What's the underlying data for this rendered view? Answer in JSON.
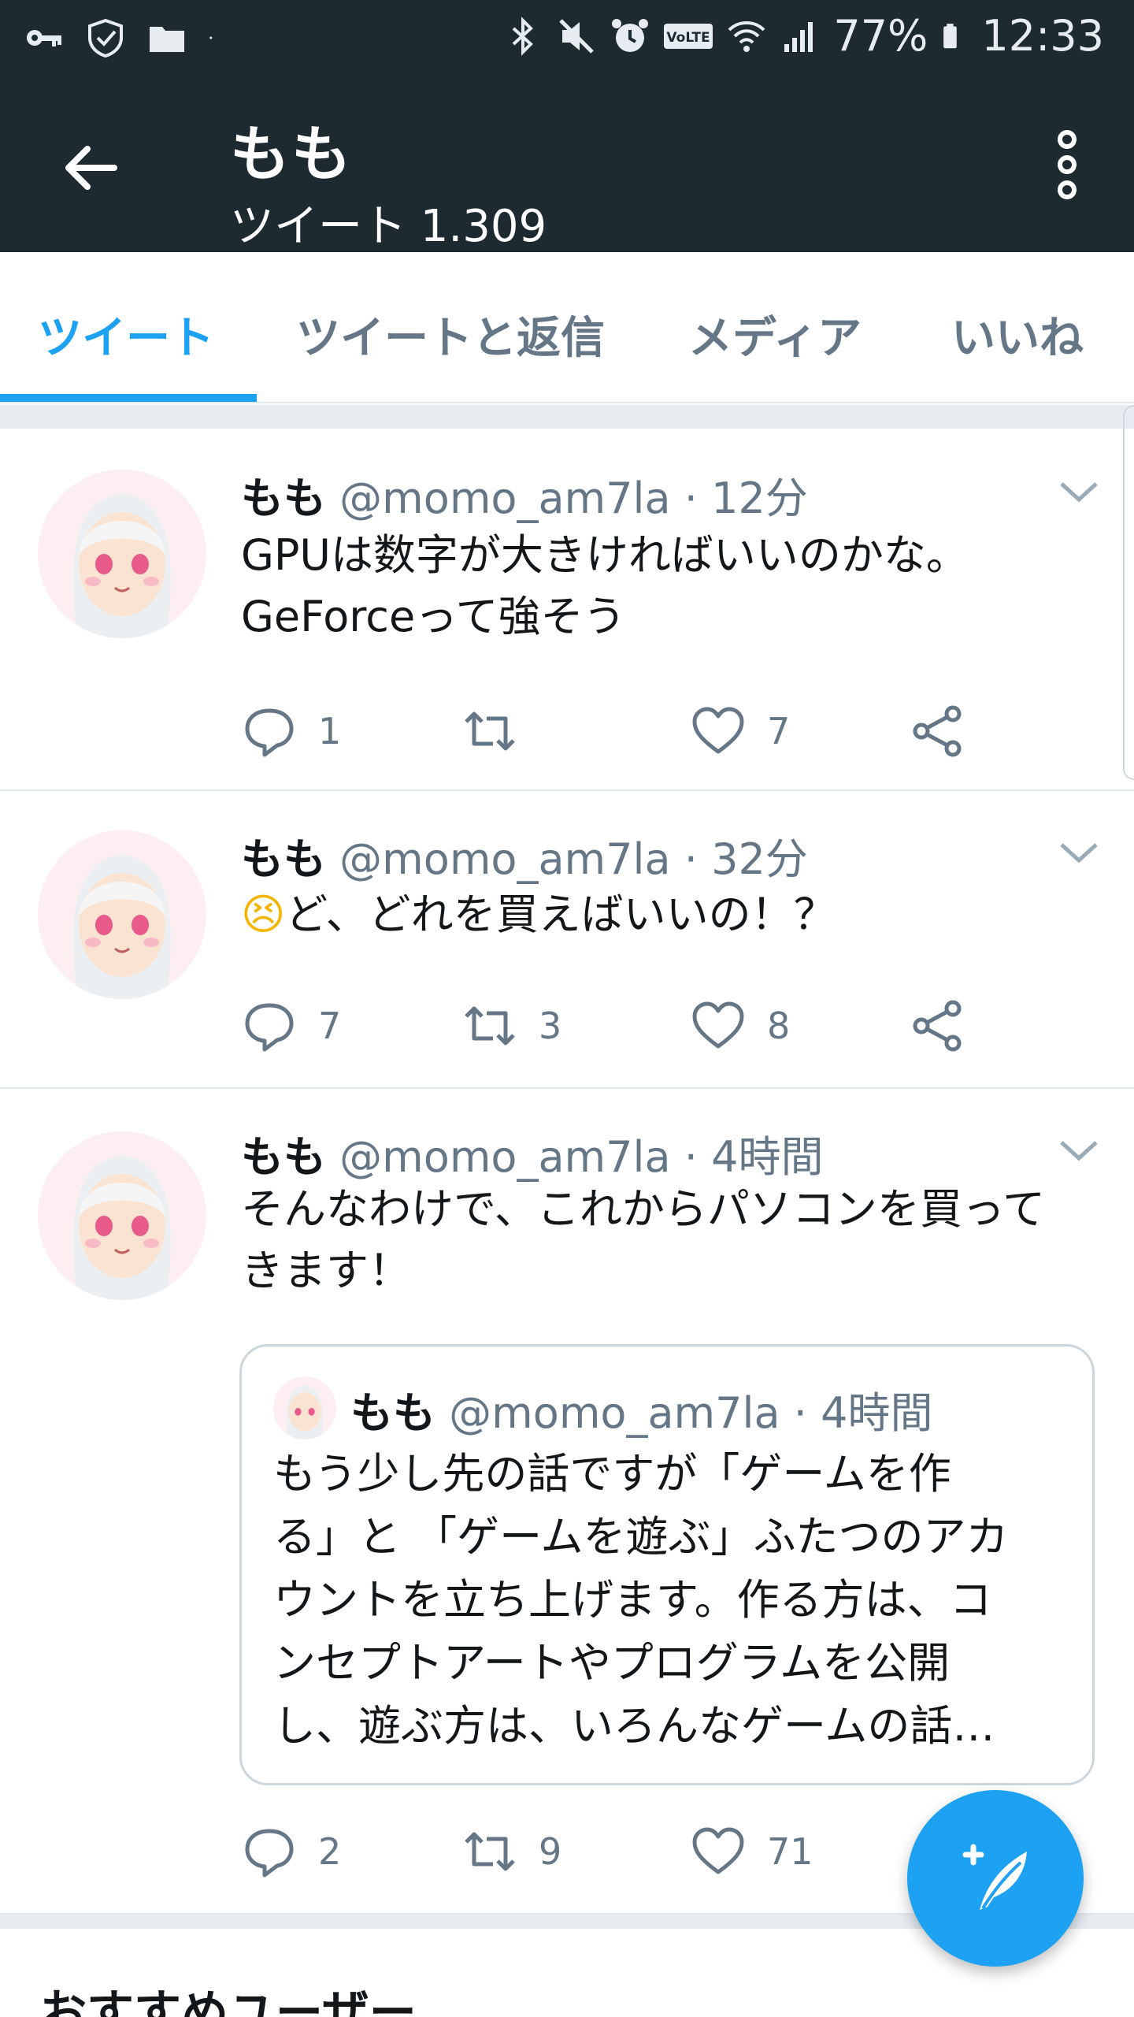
{
  "status_bar": {
    "battery": "77%",
    "time": "12:33",
    "volte": "VoLTE"
  },
  "app_bar": {
    "title": "もも",
    "subtitle": "ツイート 1.309"
  },
  "tabs": [
    {
      "label": "ツイート",
      "active": true
    },
    {
      "label": "ツイートと返信",
      "active": false
    },
    {
      "label": "メディア",
      "active": false
    },
    {
      "label": "いいね",
      "active": false
    }
  ],
  "tweets": [
    {
      "name": "もも",
      "meta": "@momo_am7la · 12分",
      "lines": [
        "GPUは数字が大きければいいのかな。",
        "GeForceって強そう"
      ],
      "replies": "1",
      "retweets": "",
      "likes": "7"
    },
    {
      "name": "もも",
      "meta": "@momo_am7la · 32分",
      "emoji": "😣",
      "lines": [
        "ど、どれを買えばいいの！？"
      ],
      "replies": "7",
      "retweets": "3",
      "likes": "8"
    },
    {
      "name": "もも",
      "meta": "@momo_am7la · 4時間",
      "lines": [
        "そんなわけで、これからパソコンを買って",
        "きます！"
      ],
      "quote": {
        "name": "もも",
        "meta": "@momo_am7la · 4時間",
        "lines": [
          "もう少し先の話ですが「ゲームを作",
          "る」と 「ゲームを遊ぶ」ふたつのアカ",
          "ウントを立ち上げます。作る方は、コ",
          "ンセプトアートやプログラムを公開",
          "し、遊ぶ方は、いろんなゲームの話…"
        ]
      },
      "replies": "2",
      "retweets": "9",
      "likes": "71"
    }
  ],
  "suggested_users_title": "おすすめユーザー",
  "colors": {
    "header_bg": "#1d2a30",
    "accent": "#1da1f2",
    "muted": "#657786"
  },
  "icons": [
    "key-icon",
    "shield-icon",
    "folder-icon",
    "bluetooth-icon",
    "mute-icon",
    "alarm-icon",
    "wifi-icon",
    "signal-icon",
    "battery-icon",
    "back-arrow-icon",
    "more-vert-icon",
    "reply-icon",
    "retweet-icon",
    "like-icon",
    "share-icon",
    "chevron-down-icon",
    "compose-icon"
  ]
}
